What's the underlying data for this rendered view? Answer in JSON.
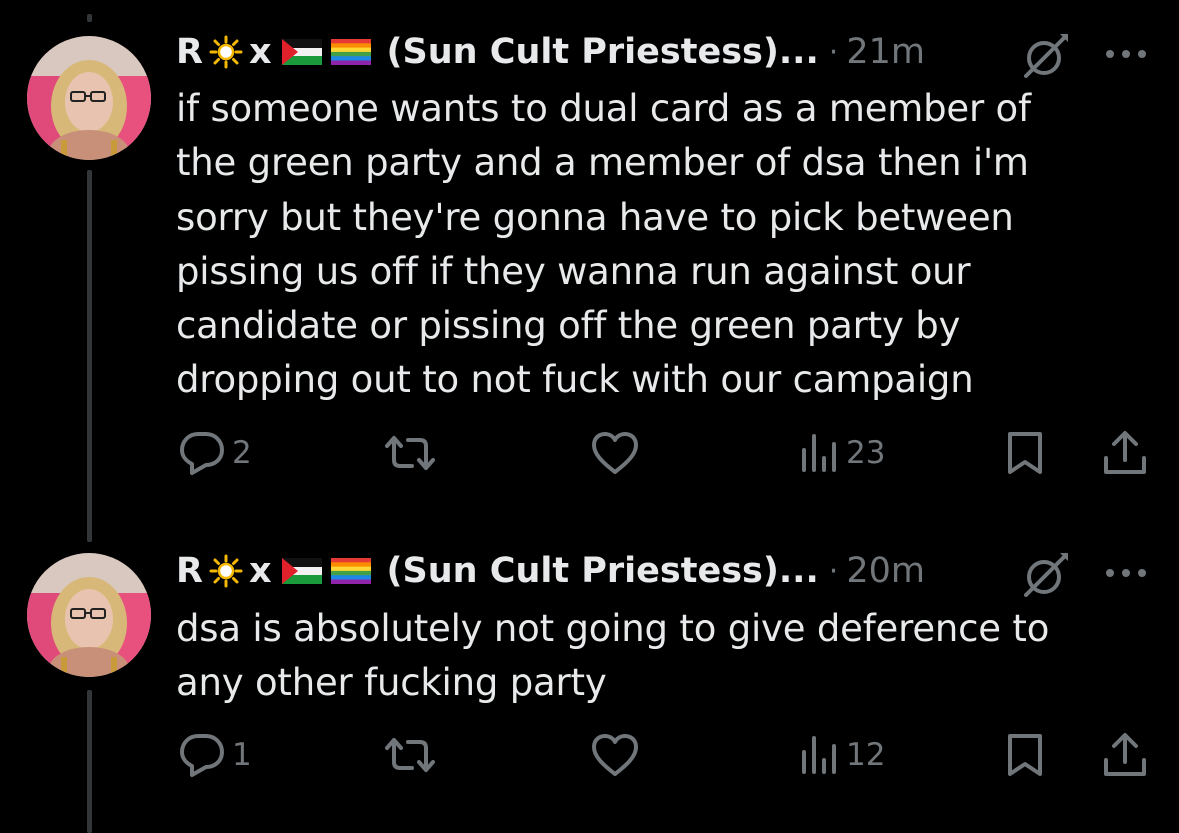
{
  "colors": {
    "background": "#000000",
    "text": "#e7e9ea",
    "secondary": "#71767b",
    "thread_line": "#333639"
  },
  "tweets": [
    {
      "author": {
        "initial": "R",
        "x": "x",
        "suffix": "(Sun Cult Priestess)...",
        "icons": [
          "sun-icon",
          "palestine-flag-icon",
          "rainbow-flag-icon"
        ]
      },
      "dot": "·",
      "time": "21m",
      "text": "if someone wants to dual card as a member of\nthe green party and a member of dsa then i'm\nsorry but they're gonna have to pick between\npissing us off if they wanna  run against our\ncandidate or pissing off the green party by\ndropping out to not fuck with our campaign",
      "replies": "2",
      "views": "23"
    },
    {
      "author": {
        "initial": "R",
        "x": "x",
        "suffix": "(Sun Cult Priestess)...",
        "icons": [
          "sun-icon",
          "palestine-flag-icon",
          "rainbow-flag-icon"
        ]
      },
      "dot": "·",
      "time": "20m",
      "text": "dsa is absolutely not going to give deference to\nany other fucking party",
      "replies": "1",
      "views": "12"
    }
  ]
}
